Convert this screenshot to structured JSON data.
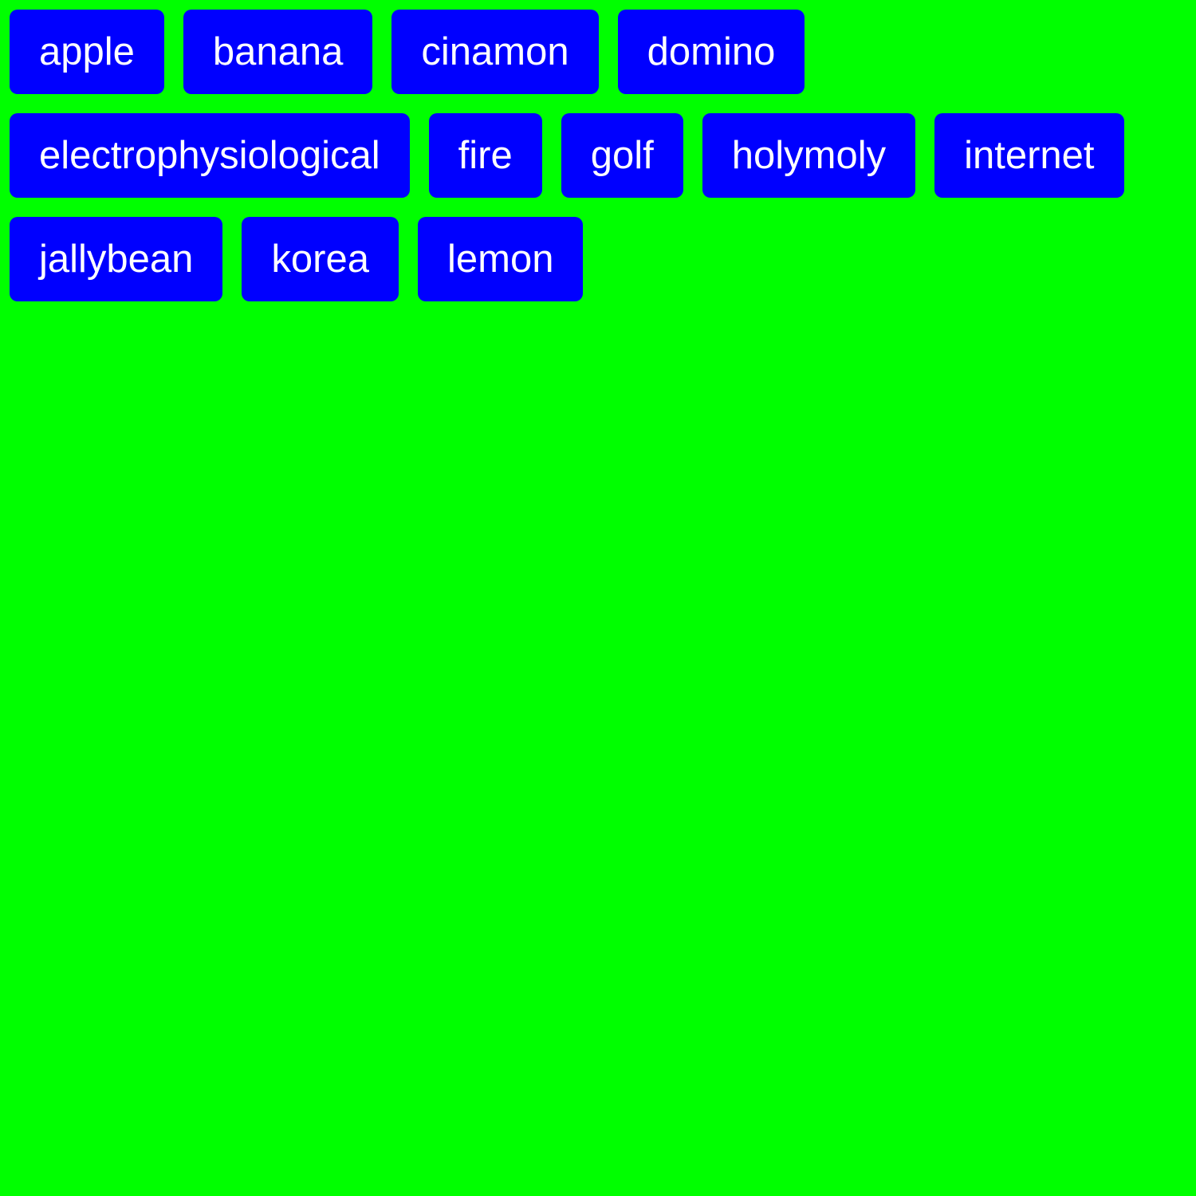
{
  "colors": {
    "background": "#00ff00",
    "tag_background": "#0000ff",
    "tag_text": "#ffffff"
  },
  "tags": [
    {
      "label": "apple"
    },
    {
      "label": "banana"
    },
    {
      "label": "cinamon"
    },
    {
      "label": "domino"
    },
    {
      "label": "electrophysiological"
    },
    {
      "label": "fire"
    },
    {
      "label": "golf"
    },
    {
      "label": "holymoly"
    },
    {
      "label": "internet"
    },
    {
      "label": "jallybean"
    },
    {
      "label": "korea"
    },
    {
      "label": "lemon"
    }
  ]
}
